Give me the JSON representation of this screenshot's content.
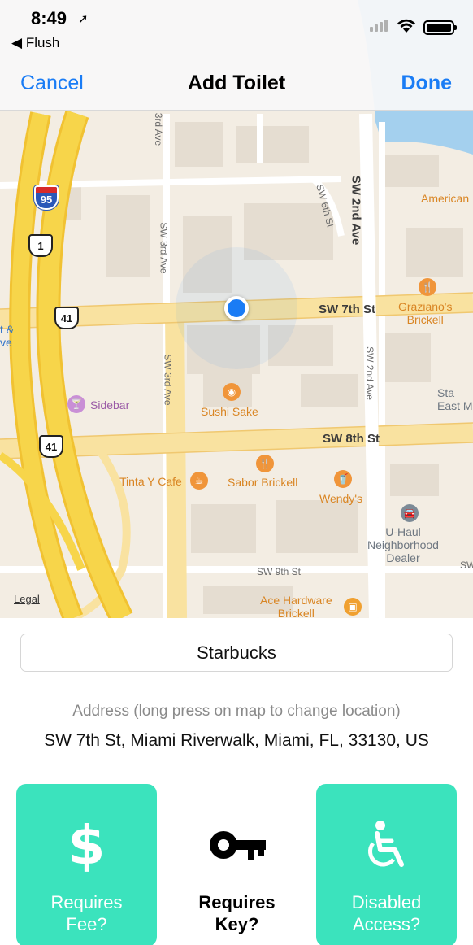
{
  "status_bar": {
    "time": "8:49",
    "back_app": "Flush"
  },
  "nav": {
    "cancel": "Cancel",
    "title": "Add Toilet",
    "done": "Done"
  },
  "map": {
    "streets": {
      "sw_7th": "SW 7th St",
      "sw_8th": "SW 8th St",
      "sw_9th": "SW 9th St",
      "sw_6th": "SW 6th St",
      "sw_2nd_ave": "SW 2nd Ave",
      "sw_2nd_ave_small": "SW 2nd Ave",
      "sw_3rd_ave_top": "SW 3rd Ave",
      "sw_3rd_ave_mid": "SW 3rd Ave",
      "sw_3rd_ave_low": "SW 3rd Ave",
      "rd_ave_top": "3rd Ave"
    },
    "shields": {
      "i95": "95",
      "us1": "1",
      "us41_a": "41",
      "us41_b": "41"
    },
    "pois": {
      "american": "American",
      "grazianos": "Graziano's\nBrickell",
      "sidebar": "Sidebar",
      "sushi_sake": "Sushi Sake",
      "sta": "Sta\nEast M",
      "tinta": "Tinta Y Cafe",
      "sabor": "Sabor Brickell",
      "wendys": "Wendy's",
      "uhaul": "U-Haul\nNeighborhood\nDealer",
      "ace": "Ace Hardware\nBrickell",
      "left_edge": "t &\nve",
      "sw_edge": "SW",
      "s_edge": "S"
    },
    "legal": "Legal"
  },
  "form": {
    "name_value": "Starbucks",
    "address_hint": "Address (long press on map to change location)",
    "address_value": "SW 7th St, Miami Riverwalk, Miami, FL, 33130, US"
  },
  "options": [
    {
      "label": "Requires\nFee?",
      "icon": "dollar-icon",
      "selected": true
    },
    {
      "label": "Requires\nKey?",
      "icon": "key-icon",
      "selected": false
    },
    {
      "label": "Disabled\nAccess?",
      "icon": "wheelchair-icon",
      "selected": true
    }
  ],
  "colors": {
    "accent": "#1a7cf5",
    "option_selected": "#3be3bd",
    "map_bg": "#f3ede3",
    "highway": "#f7d54a"
  }
}
